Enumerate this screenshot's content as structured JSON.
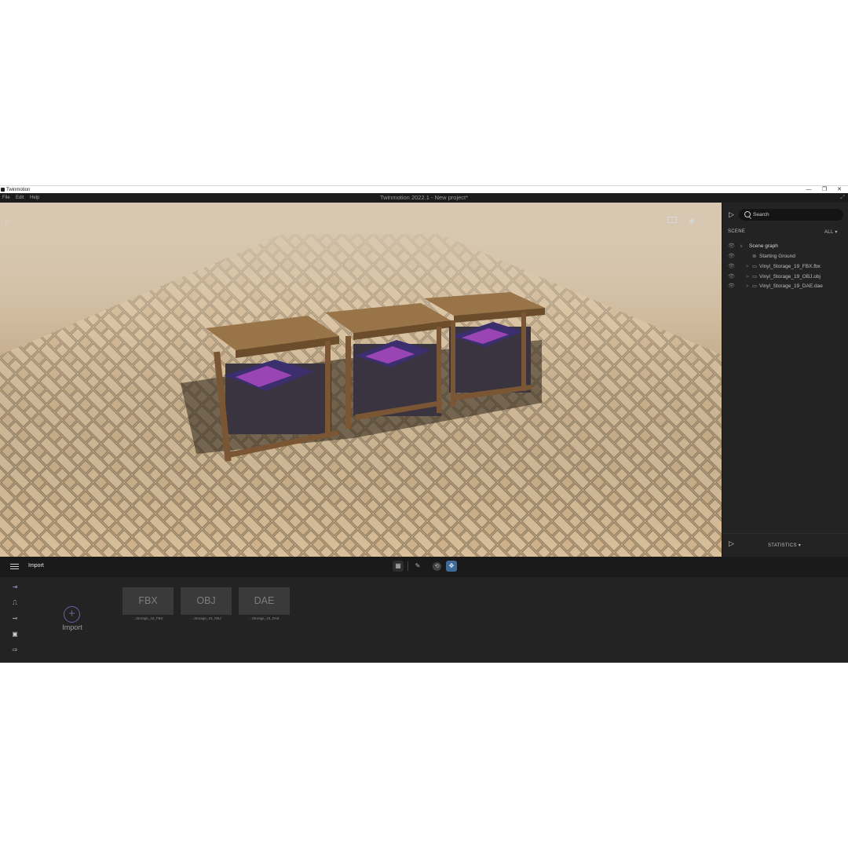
{
  "os_window": {
    "title": "Twinmotion",
    "controls": [
      "—",
      "❐",
      "✕"
    ]
  },
  "menubar": {
    "items": [
      "File",
      "Edit",
      "Help"
    ],
    "app_title": "Twinmotion 2022.1 - New project*",
    "expand_icon": "expand-icon"
  },
  "viewport": {
    "icons": [
      "play-icon",
      "aspect-ratio-icon",
      "visibility-icon"
    ]
  },
  "right_panel": {
    "search_placeholder": "Search",
    "scene_label": "SCENE",
    "filter_label": "ALL",
    "tree": [
      {
        "label": "Scene graph",
        "depth": 0,
        "type": "root",
        "expanded": true
      },
      {
        "label": "Starting Ground",
        "depth": 1,
        "type": "ground"
      },
      {
        "label": "Vinyl_Storage_19_FBX.fbx",
        "depth": 1,
        "type": "folder"
      },
      {
        "label": "Vinyl_Storage_19_OBJ.obj",
        "depth": 1,
        "type": "folder"
      },
      {
        "label": "Vinyl_Storage_19_DAE.dae",
        "depth": 1,
        "type": "folder"
      }
    ],
    "statistics_label": "STATISTICS"
  },
  "bottom_toolbar": {
    "section_label": "Import",
    "tools": [
      "grid-icon",
      "eyedropper-icon",
      "orbit-icon",
      "move-icon"
    ],
    "active_tool": "move-icon"
  },
  "bottom_panel": {
    "sidebar_icons": [
      "import-icon",
      "animation-icon",
      "settings-slider-icon",
      "media-icon",
      "export-icon"
    ],
    "import_label": "Import",
    "assets": [
      {
        "tile": "FBX",
        "caption": "...Storage_19_FBX"
      },
      {
        "tile": "OBJ",
        "caption": "...Storage_19_OBJ"
      },
      {
        "tile": "DAE",
        "caption": "...Storage_19_DAE"
      }
    ]
  },
  "colors": {
    "accent": "#6f5fa8",
    "panel": "#232323",
    "toolbar": "#1a1a1a",
    "active_tool": "#3d6b9a"
  }
}
